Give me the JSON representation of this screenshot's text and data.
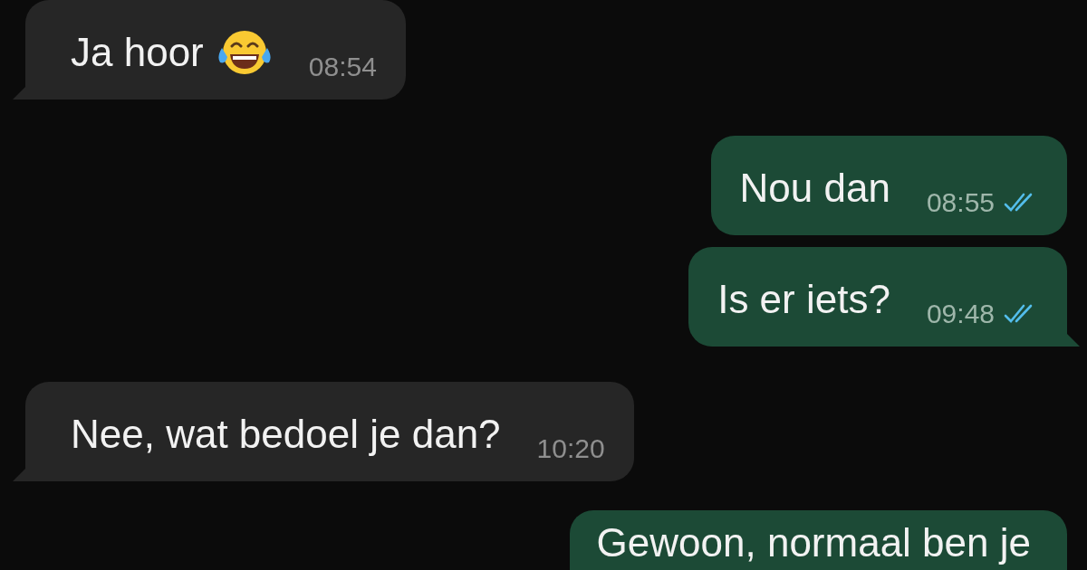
{
  "messages": [
    {
      "kind": "incoming",
      "text": "Ja hoor",
      "emoji": true,
      "time": "08:54",
      "tail": true
    },
    {
      "kind": "outgoing",
      "text": "Nou dan",
      "time": "08:55",
      "read": true,
      "tail": false
    },
    {
      "kind": "outgoing",
      "text": "Is er iets?",
      "time": "09:48",
      "read": true,
      "tail": true
    },
    {
      "kind": "incoming",
      "text": "Nee, wat bedoel je dan?",
      "time": "10:20",
      "tail": true
    },
    {
      "kind": "outgoing",
      "text": "Gewoon, normaal ben je"
    }
  ]
}
